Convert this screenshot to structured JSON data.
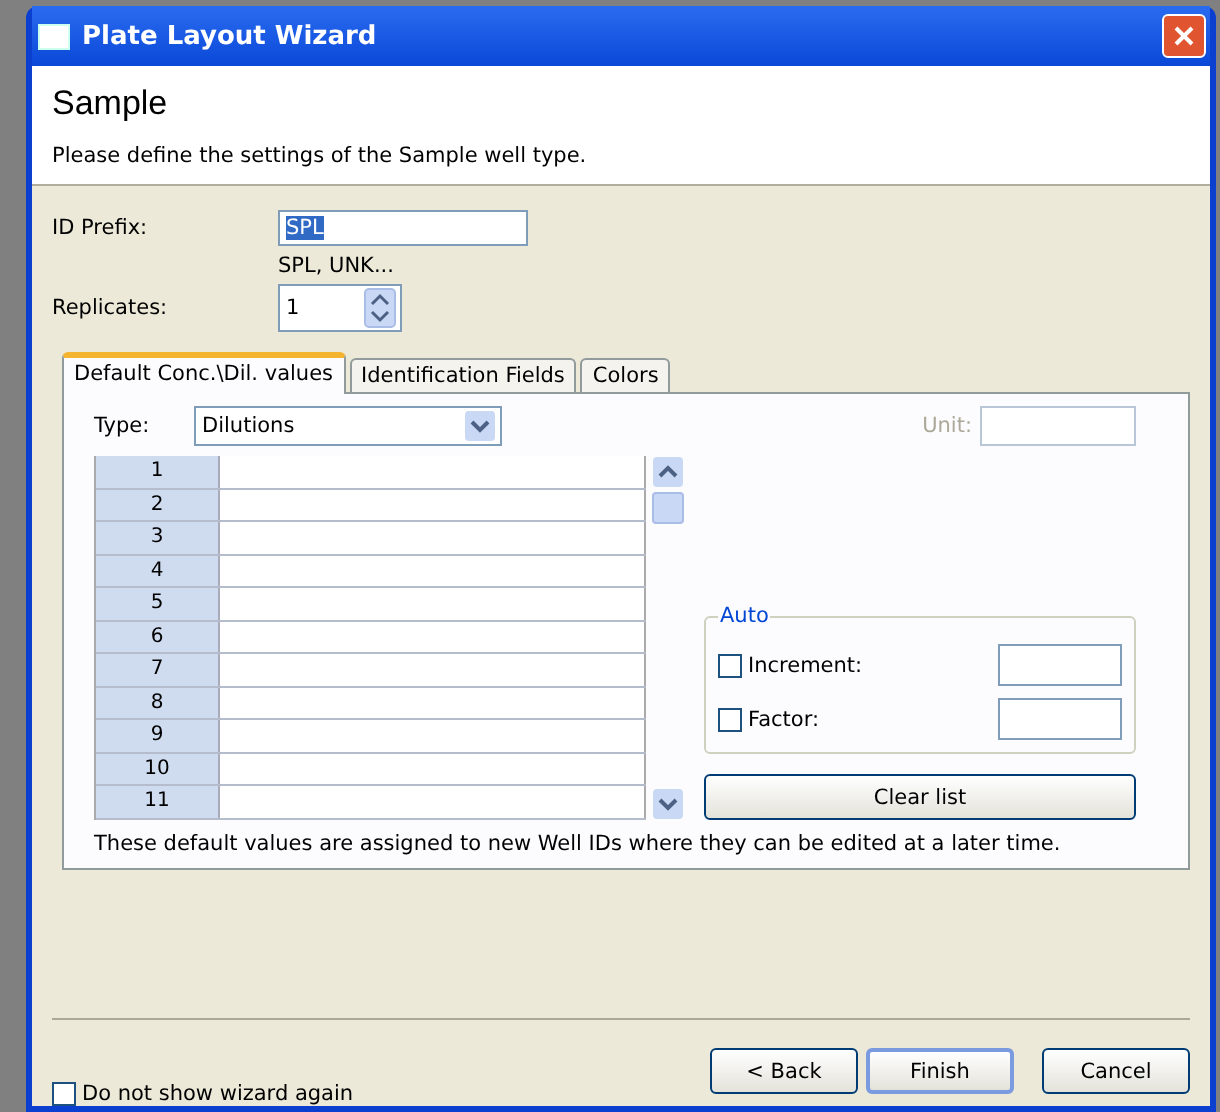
{
  "window": {
    "title": "Plate Layout Wizard"
  },
  "header": {
    "title": "Sample",
    "description": "Please define the settings of the Sample well type."
  },
  "id_prefix": {
    "label": "ID Prefix:",
    "value": "SPL",
    "hint": "SPL, UNK..."
  },
  "replicates": {
    "label": "Replicates:",
    "value": "1"
  },
  "tabs": [
    {
      "label": "Default Conc.\\Dil. values",
      "selected": true
    },
    {
      "label": "Identification Fields",
      "selected": false
    },
    {
      "label": "Colors",
      "selected": false
    }
  ],
  "type": {
    "label": "Type:",
    "value": "Dilutions"
  },
  "unit": {
    "label": "Unit:",
    "disabled": true
  },
  "rows": [
    "1",
    "2",
    "3",
    "4",
    "5",
    "6",
    "7",
    "8",
    "9",
    "10",
    "11"
  ],
  "auto": {
    "title": "Auto",
    "options": [
      {
        "label": "Increment:",
        "checked": false
      },
      {
        "label": "Factor:",
        "checked": false
      }
    ]
  },
  "clear_button": "Clear list",
  "note": "These default values are assigned to new Well IDs where they can be edited at a later time.",
  "dont_show": {
    "label": "Do not show wizard again",
    "checked": false
  },
  "buttons": [
    {
      "label": "< Back",
      "default": false
    },
    {
      "label": "Finish",
      "default": true
    },
    {
      "label": "Cancel",
      "default": false
    }
  ]
}
